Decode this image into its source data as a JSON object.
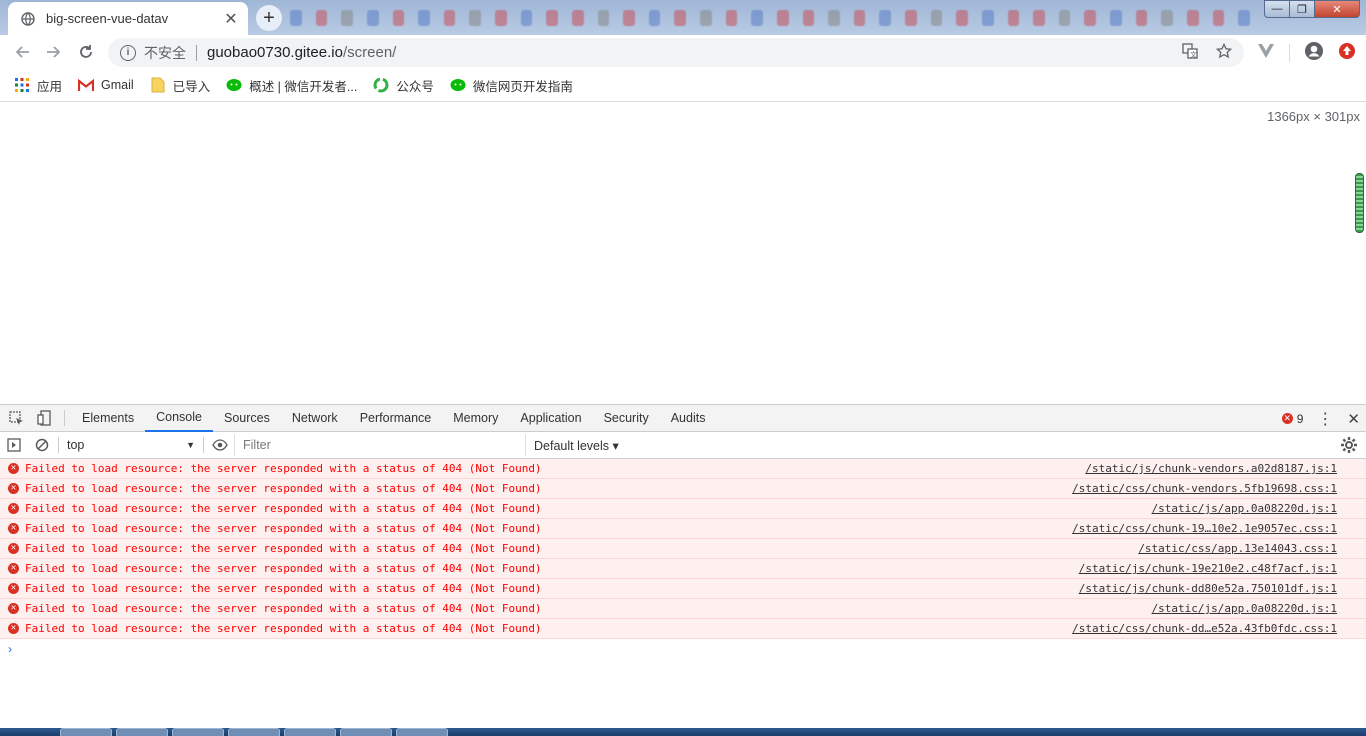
{
  "browser": {
    "tab_title": "big-screen-vue-datav",
    "new_tab_label": "+",
    "window_controls": [
      "—",
      "❐",
      "✕"
    ]
  },
  "address": {
    "security_label": "不安全",
    "host": "guobao0730.gitee.io",
    "path": "/screen/"
  },
  "bookmarks": [
    {
      "label": "应用",
      "icon": "apps-grid-icon"
    },
    {
      "label": "Gmail",
      "icon": "gmail-icon"
    },
    {
      "label": "已导入",
      "icon": "folder-icon"
    },
    {
      "label": "概述 | 微信开发者...",
      "icon": "wechat-icon"
    },
    {
      "label": "公众号",
      "icon": "refresh-green-icon"
    },
    {
      "label": "微信网页开发指南",
      "icon": "wechat-icon"
    }
  ],
  "viewport": {
    "dimensions_label": "1366px × 301px"
  },
  "devtools": {
    "tabs": [
      "Elements",
      "Console",
      "Sources",
      "Network",
      "Performance",
      "Memory",
      "Application",
      "Security",
      "Audits"
    ],
    "active_tab": "Console",
    "error_count": "9",
    "context": "top",
    "filter_placeholder": "Filter",
    "levels_label": "Default levels ▾",
    "messages": [
      {
        "text": "Failed to load resource: the server responded with a status of 404 (Not Found)",
        "source": "/static/js/chunk-vendors.a02d8187.js:1"
      },
      {
        "text": "Failed to load resource: the server responded with a status of 404 (Not Found)",
        "source": "/static/css/chunk-vendors.5fb19698.css:1"
      },
      {
        "text": "Failed to load resource: the server responded with a status of 404 (Not Found)",
        "source": "/static/js/app.0a08220d.js:1"
      },
      {
        "text": "Failed to load resource: the server responded with a status of 404 (Not Found)",
        "source": "/static/css/chunk-19…10e2.1e9057ec.css:1"
      },
      {
        "text": "Failed to load resource: the server responded with a status of 404 (Not Found)",
        "source": "/static/css/app.13e14043.css:1"
      },
      {
        "text": "Failed to load resource: the server responded with a status of 404 (Not Found)",
        "source": "/static/js/chunk-19e210e2.c48f7acf.js:1"
      },
      {
        "text": "Failed to load resource: the server responded with a status of 404 (Not Found)",
        "source": "/static/js/chunk-dd80e52a.750101df.js:1"
      },
      {
        "text": "Failed to load resource: the server responded with a status of 404 (Not Found)",
        "source": "/static/js/app.0a08220d.js:1"
      },
      {
        "text": "Failed to load resource: the server responded with a status of 404 (Not Found)",
        "source": "/static/css/chunk-dd…e52a.43fb0fdc.css:1"
      }
    ],
    "prompt_symbol": "›"
  },
  "colors": {
    "error_text": "#ff0000",
    "error_bg": "#fff0f0",
    "accent": "#1a73e8"
  }
}
